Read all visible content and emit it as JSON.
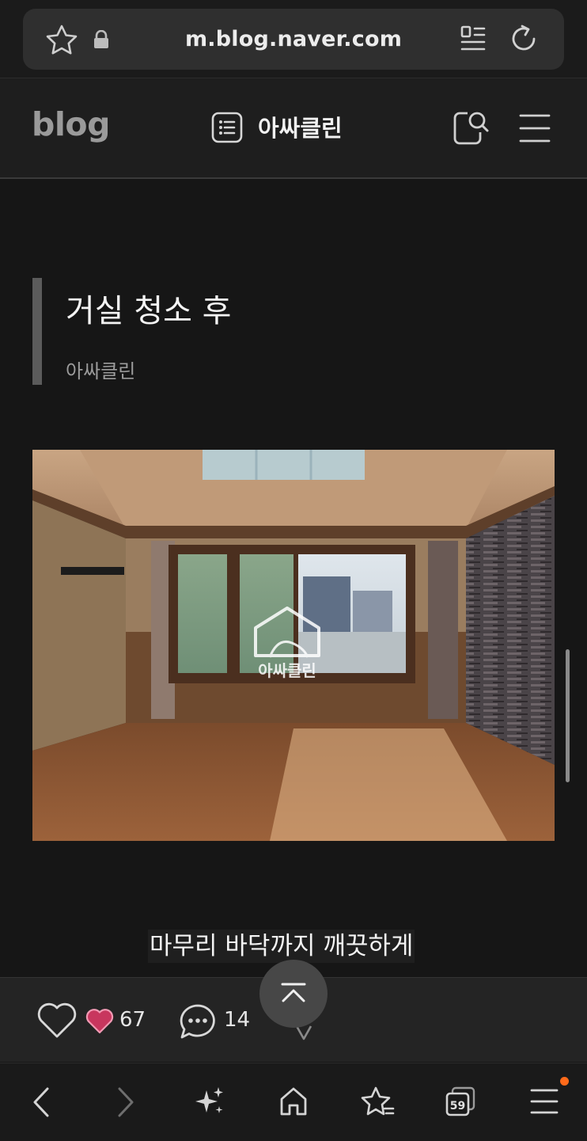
{
  "browser": {
    "url": "m.blog.naver.com",
    "tab_count": "59",
    "icons": [
      "star-outline-icon",
      "lock-icon",
      "reader-mode-icon",
      "reload-icon"
    ],
    "notification_color": "#ff6a1a"
  },
  "blog_header": {
    "logo": "blog",
    "blog_name": "아싸클린",
    "icons": [
      "post-list-icon",
      "search-icon",
      "menu-icon"
    ]
  },
  "post": {
    "title": "거실 청소 후",
    "author": "아싸클린",
    "photo_watermark": "아싸클린",
    "caption": "마무리 바닥까지 깨끗하게"
  },
  "reactions": {
    "like_count": "67",
    "comment_count": "14"
  },
  "bottom_nav": {
    "items": [
      "back",
      "forward",
      "ai-sparkle",
      "home",
      "bookmarks",
      "tabs",
      "menu"
    ]
  }
}
